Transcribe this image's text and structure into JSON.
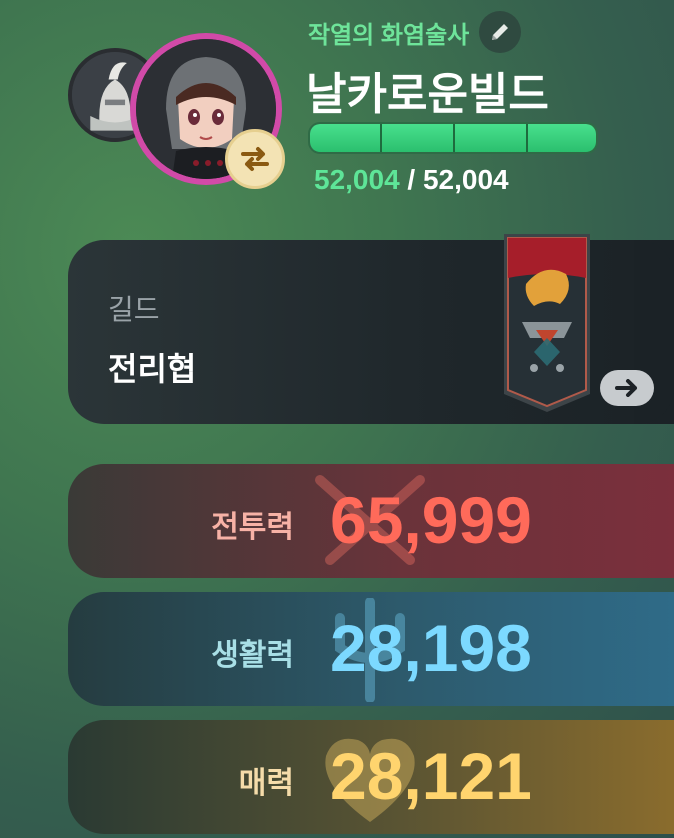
{
  "profile": {
    "title": "작열의 화염술사",
    "name": "날카로운빌드",
    "hp_current": "52,004",
    "hp_separator": "/",
    "hp_max": "52,004",
    "hp_fraction": 1.0
  },
  "guild": {
    "label": "길드",
    "name": "전리협"
  },
  "stats": {
    "combat": {
      "label": "전투력",
      "value": "65,999"
    },
    "life": {
      "label": "생활력",
      "value": "28,198"
    },
    "charm": {
      "label": "매력",
      "value": "28,121"
    }
  },
  "colors": {
    "accent_green": "#6ee49a",
    "avatar_ring": "#d14aa8",
    "combat": "#ff6a5a",
    "life": "#7cd9ff",
    "charm": "#ffd46e"
  },
  "icons": {
    "edit": "pencil-icon",
    "swap": "swap-arrows-icon",
    "guild_link": "arrow-right-icon"
  }
}
